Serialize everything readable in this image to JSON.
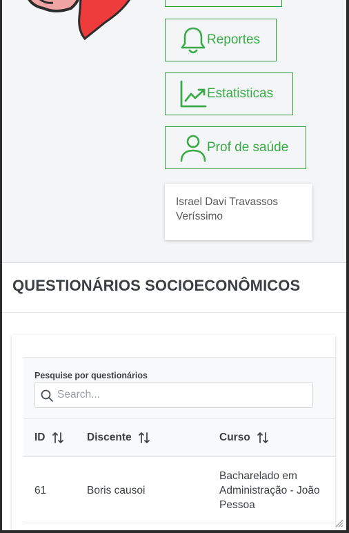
{
  "nav": {
    "buttons": [
      {
        "label": "",
        "icon": "partial-button-icon"
      },
      {
        "label": "Reportes",
        "icon": "bell-icon"
      },
      {
        "label": "Estatisticas",
        "icon": "chart-line-icon"
      },
      {
        "label": "Prof de saúde",
        "icon": "person-icon"
      }
    ]
  },
  "user_card": {
    "name": "Israel Davi Travassos Veríssimo"
  },
  "section": {
    "title": "QUESTIONÁRIOS SOCIOECONÔMICOS"
  },
  "search": {
    "label": "Pesquise por questionários",
    "placeholder": "Search..."
  },
  "table": {
    "columns": [
      "ID",
      "Discente",
      "Curso"
    ],
    "rows": [
      {
        "id": "61",
        "discente": "Boris causoi",
        "curso": "Bacharelado em Administração - João Pessoa"
      }
    ]
  },
  "colors": {
    "accent": "#3aaa48",
    "panel_bg": "#f4f5f7",
    "text": "#3b3f44"
  }
}
